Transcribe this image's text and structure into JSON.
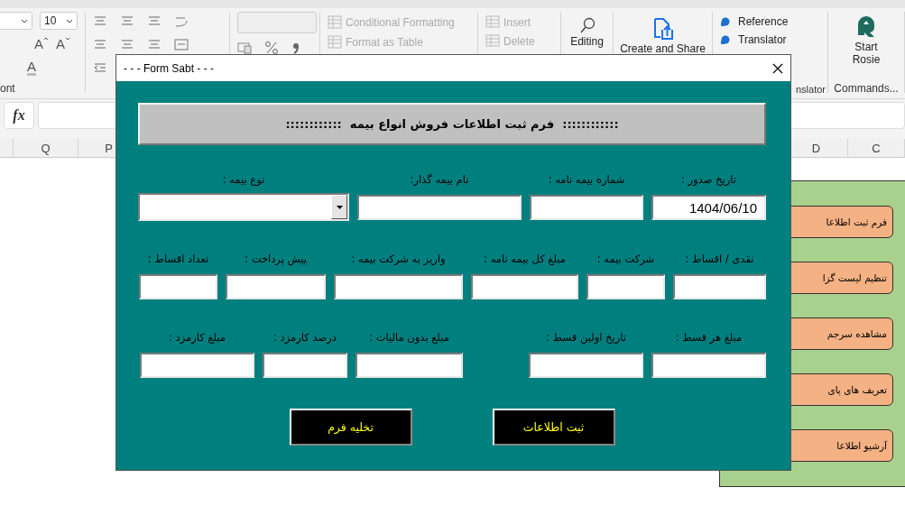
{
  "ribbon": {
    "font_size": "10",
    "font_buttons": [
      "A",
      "A",
      "A"
    ],
    "font_group_label": "ont",
    "styles": [
      {
        "label": "Conditional Formatting",
        "disabled": true
      },
      {
        "label": "Format as Table",
        "disabled": true
      }
    ],
    "cells": [
      {
        "label": "Insert",
        "disabled": true
      },
      {
        "label": "Delete",
        "disabled": true
      }
    ],
    "editing": "Editing",
    "create_share": "Create and Share",
    "translator_items": [
      "Reference",
      "Translator"
    ],
    "translator_group_label": "nslator",
    "rosie_button": "Start Rosie",
    "commands_group_label": "Commands..."
  },
  "formula_bar": {
    "fx": "fx"
  },
  "columns": [
    "C",
    "D",
    "P",
    "Q"
  ],
  "side_panel": {
    "buttons": [
      "فرم ثبت اطلاعا",
      "تنظیم لیست گزا",
      "مشاهده سرجم",
      "تعریف های پای",
      "آرشیو اطلاعا"
    ]
  },
  "dialog": {
    "title": "- - - Form Sabt - - -",
    "heading": "::::::::::::  فرم ثبت اطلاعات فروش انواع بیمه  ::::::::::::",
    "sections": [
      {
        "fields": [
          {
            "kind": "text",
            "label": "تاریخ صدور :",
            "value": "1404/06/10"
          },
          {
            "kind": "text",
            "label": "شماره بیمه نامه :"
          },
          {
            "kind": "text",
            "label": "نام بیمه گذار:"
          },
          {
            "kind": "combo",
            "label": "نوع بیمه :"
          }
        ]
      },
      {
        "fields": [
          {
            "kind": "text",
            "label": "نقدی / اقساط :"
          },
          {
            "kind": "text",
            "label": "شرکت بیمه :"
          },
          {
            "kind": "text",
            "label": "مبلغ کل بیمه نامه :"
          },
          {
            "kind": "text",
            "label": "واریز به شرکت بیمه :"
          },
          {
            "kind": "text",
            "label": "پیش پرداخت :"
          },
          {
            "kind": "text",
            "label": "تعداد اقساط :"
          }
        ]
      },
      {
        "fields": [
          {
            "kind": "text",
            "label": "مبلغ هر قسط :"
          },
          {
            "kind": "text",
            "label": "تاریخ اولین قسط :"
          },
          {
            "kind": "text",
            "label": "مبلغ بدون مالیات :"
          },
          {
            "kind": "text",
            "label": "درصد کارمزد :"
          },
          {
            "kind": "text",
            "label": "مبلغ کارمزد :"
          }
        ]
      }
    ],
    "buttons": [
      "ثبت اطلاعات",
      "تخلیه فرم"
    ]
  }
}
